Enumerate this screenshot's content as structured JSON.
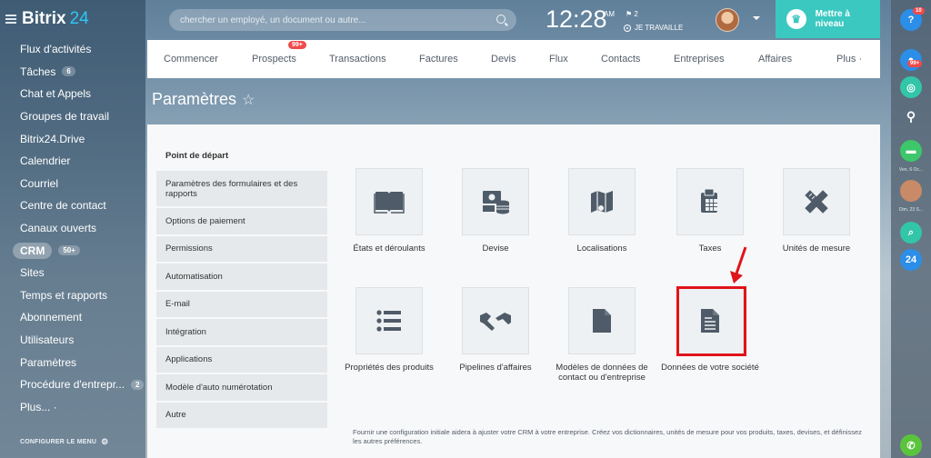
{
  "logo": {
    "text": "Bitrix",
    "number": "24"
  },
  "sidebar": {
    "items": [
      {
        "label": "Flux d'activités",
        "counter": ""
      },
      {
        "label": "Tâches",
        "counter": "6"
      },
      {
        "label": "Chat et Appels",
        "counter": ""
      },
      {
        "label": "Groupes de travail",
        "counter": ""
      },
      {
        "label": "Bitrix24.Drive",
        "counter": ""
      },
      {
        "label": "Calendrier",
        "counter": ""
      },
      {
        "label": "Courriel",
        "counter": ""
      },
      {
        "label": "Centre de contact",
        "counter": ""
      },
      {
        "label": "Canaux ouverts",
        "counter": ""
      },
      {
        "label": "CRM",
        "counter": "50+"
      },
      {
        "label": "Sites",
        "counter": ""
      },
      {
        "label": "Temps et rapports",
        "counter": ""
      },
      {
        "label": "Abonnement",
        "counter": ""
      },
      {
        "label": "Utilisateurs",
        "counter": ""
      },
      {
        "label": "Paramètres",
        "counter": ""
      },
      {
        "label": "Procédure d'entrepr...",
        "counter": "2"
      },
      {
        "label": "Plus... ·",
        "counter": ""
      }
    ],
    "config_label": "CONFIGURER LE MENU"
  },
  "header": {
    "search_placeholder": "chercher un employé, un document ou autre...",
    "time": "12:28",
    "ampm": "AM",
    "flag_count": "2",
    "work_status": "JE TRAVAILLE",
    "upgrade_label": "Mettre à niveau"
  },
  "rightbar": {
    "help_badge": "10",
    "notif_badge": "99+",
    "date1": "Ven, 6 Oc...",
    "date2": "Dim, 23 S...",
    "b24": "24"
  },
  "nav": {
    "items": [
      "Commencer",
      "Prospects",
      "Transactions",
      "Factures",
      "Devis",
      "Flux",
      "Contacts",
      "Entreprises",
      "Affaires",
      "Plus ·"
    ],
    "prospects_badge": "99+"
  },
  "page_title": "Paramètres",
  "left_menu": [
    "Point de départ",
    "Paramètres des formulaires et des rapports",
    "Options de paiement",
    "Permissions",
    "Automatisation",
    "E-mail",
    "Intégration",
    "Applications",
    "Modèle d'auto numérotation",
    "Autre"
  ],
  "tiles": [
    {
      "label": "États et déroulants",
      "icon": "book-icon"
    },
    {
      "label": "Devise",
      "icon": "coins-icon"
    },
    {
      "label": "Localisations",
      "icon": "map-icon"
    },
    {
      "label": "Taxes",
      "icon": "calculator-icon"
    },
    {
      "label": "Unités de mesure",
      "icon": "ruler-pencil-icon"
    },
    {
      "label": "Propriétés des produits",
      "icon": "list-icon"
    },
    {
      "label": "Pipelines d'affaires",
      "icon": "handshake-icon"
    },
    {
      "label": "Modèles de données de contact ou d'entreprise",
      "icon": "file-icon"
    },
    {
      "label": "Données de votre société",
      "icon": "document-icon"
    }
  ],
  "footer_note": "Fournir une configuration initiale aidera à ajuster votre CRM à votre entreprise. Créez vos dictionnaires, unités de mesure pour vos produits, taxes, devises, et définissez les autres préférences.",
  "colors": {
    "accent": "#3bc8c0",
    "highlight": "#e0141a",
    "badge": "#f04a4a",
    "icon": "#4f5b68"
  }
}
